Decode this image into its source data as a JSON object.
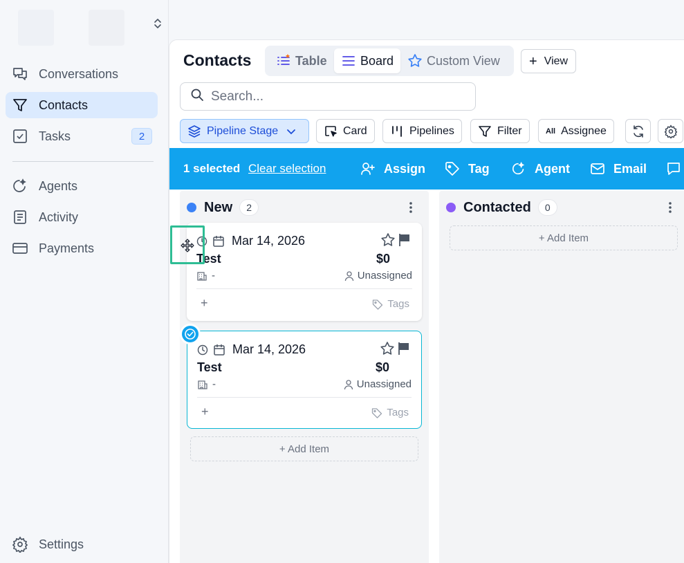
{
  "sidebar": {
    "items": [
      {
        "label": "Conversations",
        "icon": "chat-icon"
      },
      {
        "label": "Contacts",
        "icon": "filter-funnel-icon"
      },
      {
        "label": "Tasks",
        "icon": "checkbox-icon",
        "badge": "2"
      },
      {
        "label": "Agents",
        "icon": "sparkle-agent-icon"
      },
      {
        "label": "Activity",
        "icon": "document-icon"
      },
      {
        "label": "Payments",
        "icon": "credit-card-icon"
      }
    ],
    "settings_label": "Settings"
  },
  "header": {
    "title": "Contacts",
    "tabs": [
      {
        "label": "Table"
      },
      {
        "label": "Board"
      },
      {
        "label": "Custom View"
      }
    ],
    "add_view_label": "View",
    "search_placeholder": "Search..."
  },
  "toolbar": {
    "pipeline_stage": "Pipeline Stage",
    "card": "Card",
    "pipelines": "Pipelines",
    "filter": "Filter",
    "assignee_prefix": "All",
    "assignee": "Assignee"
  },
  "selection": {
    "count_text": "1 selected",
    "clear_text": "Clear selection",
    "actions": [
      "Assign",
      "Tag",
      "Agent",
      "Email"
    ]
  },
  "board": {
    "add_item": "+ Add Item",
    "columns": [
      {
        "name": "New",
        "count": "2",
        "color": "#3b82f6",
        "cards": [
          {
            "date": "Mar 14, 2026",
            "title": "Test",
            "amount": "$0",
            "company": "-",
            "assignee": "Unassigned",
            "tags": "Tags",
            "add": "+",
            "selected": false
          },
          {
            "date": "Mar 14, 2026",
            "title": "Test",
            "amount": "$0",
            "company": "-",
            "assignee": "Unassigned",
            "tags": "Tags",
            "add": "+",
            "selected": true
          }
        ]
      },
      {
        "name": "Contacted",
        "count": "0",
        "color": "#8b5cf6",
        "cards": []
      }
    ]
  },
  "colors": {
    "accent": "#11a3ee",
    "active_nav": "#dbeafe",
    "selected_card_border": "#06b6d4",
    "drag_highlight": "#2ebd94"
  }
}
